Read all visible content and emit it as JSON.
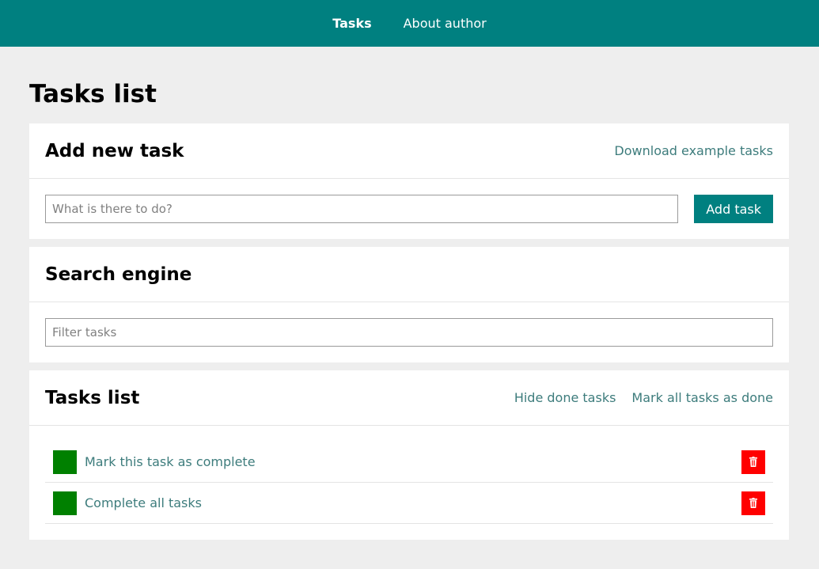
{
  "nav": {
    "items": [
      {
        "label": "Tasks",
        "active": true
      },
      {
        "label": "About author",
        "active": false
      }
    ]
  },
  "page": {
    "title": "Tasks list"
  },
  "add_panel": {
    "title": "Add new task",
    "download_link": "Download example tasks",
    "input_placeholder": "What is there to do?",
    "add_button": "Add task"
  },
  "search_panel": {
    "title": "Search engine",
    "input_placeholder": "Filter tasks"
  },
  "list_panel": {
    "title": "Tasks list",
    "hide_done_link": "Hide done tasks",
    "mark_all_link": "Mark all tasks as done",
    "tasks": [
      {
        "text": "Mark this task as complete"
      },
      {
        "text": "Complete all tasks"
      }
    ]
  },
  "colors": {
    "accent": "#008080",
    "done": "#008000",
    "delete": "#ff0000",
    "link": "#3d7c7c"
  },
  "icons": {
    "delete": "trash-icon",
    "check": "checkbox-icon"
  }
}
